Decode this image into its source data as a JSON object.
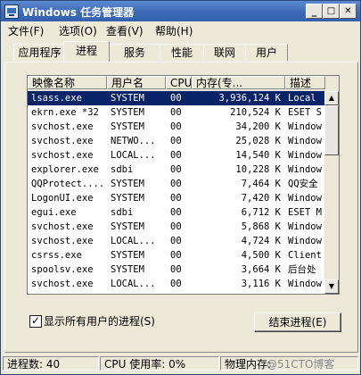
{
  "window": {
    "title": "Windows 任务管理器",
    "buttons": {
      "minimize": "_",
      "maximize": "□",
      "close": "✕"
    }
  },
  "menu": [
    {
      "label": "文件(F)"
    },
    {
      "label": "选项(O)"
    },
    {
      "label": "查看(V)"
    },
    {
      "label": "帮助(H)"
    }
  ],
  "tabs": [
    {
      "label": "应用程序",
      "active": false
    },
    {
      "label": "进程",
      "active": true
    },
    {
      "label": "服务",
      "active": false
    },
    {
      "label": "性能",
      "active": false
    },
    {
      "label": "联网",
      "active": false
    },
    {
      "label": "用户",
      "active": false
    }
  ],
  "table": {
    "columns": [
      "映像名称",
      "用户名",
      "CPU",
      "内存(专...",
      "描述"
    ],
    "rows": [
      {
        "image": "lsass.exe",
        "user": "SYSTEM",
        "cpu": "00",
        "mem": "3,936,124 K",
        "desc": "Local",
        "selected": true
      },
      {
        "image": "ekrn.exe *32",
        "user": "SYSTEM",
        "cpu": "00",
        "mem": "210,524 K",
        "desc": "ESET S"
      },
      {
        "image": "svchost.exe",
        "user": "SYSTEM",
        "cpu": "00",
        "mem": "34,200 K",
        "desc": "Window"
      },
      {
        "image": "svchost.exe",
        "user": "NETWO...",
        "cpu": "00",
        "mem": "25,028 K",
        "desc": "Window"
      },
      {
        "image": "svchost.exe",
        "user": "LOCAL...",
        "cpu": "00",
        "mem": "14,540 K",
        "desc": "Window"
      },
      {
        "image": "explorer.exe",
        "user": "sdbi",
        "cpu": "00",
        "mem": "10,228 K",
        "desc": "Window"
      },
      {
        "image": "QQProtect....",
        "user": "SYSTEM",
        "cpu": "00",
        "mem": "7,464 K",
        "desc": "QQ安全"
      },
      {
        "image": "LogonUI.exe",
        "user": "SYSTEM",
        "cpu": "00",
        "mem": "7,420 K",
        "desc": "Window"
      },
      {
        "image": "egui.exe",
        "user": "sdbi",
        "cpu": "00",
        "mem": "6,712 K",
        "desc": "ESET M"
      },
      {
        "image": "svchost.exe",
        "user": "SYSTEM",
        "cpu": "00",
        "mem": "5,868 K",
        "desc": "Window"
      },
      {
        "image": "svchost.exe",
        "user": "LOCAL...",
        "cpu": "00",
        "mem": "4,724 K",
        "desc": "Window"
      },
      {
        "image": "csrss.exe",
        "user": "SYSTEM",
        "cpu": "00",
        "mem": "4,500 K",
        "desc": "Client"
      },
      {
        "image": "spoolsv.exe",
        "user": "SYSTEM",
        "cpu": "00",
        "mem": "3,664 K",
        "desc": "后台处"
      },
      {
        "image": "svchost.exe",
        "user": "LOCAL...",
        "cpu": "00",
        "mem": "3,116 K",
        "desc": "Window"
      }
    ]
  },
  "show_all_users": {
    "label": "显示所有用户的进程(S)",
    "checked": true
  },
  "end_process_button": "结束进程(E)",
  "status": {
    "processes": "进程数: 40",
    "cpu": "CPU 使用率: 0%",
    "memory": "物理内存:"
  },
  "watermark": "@51CTO博客"
}
